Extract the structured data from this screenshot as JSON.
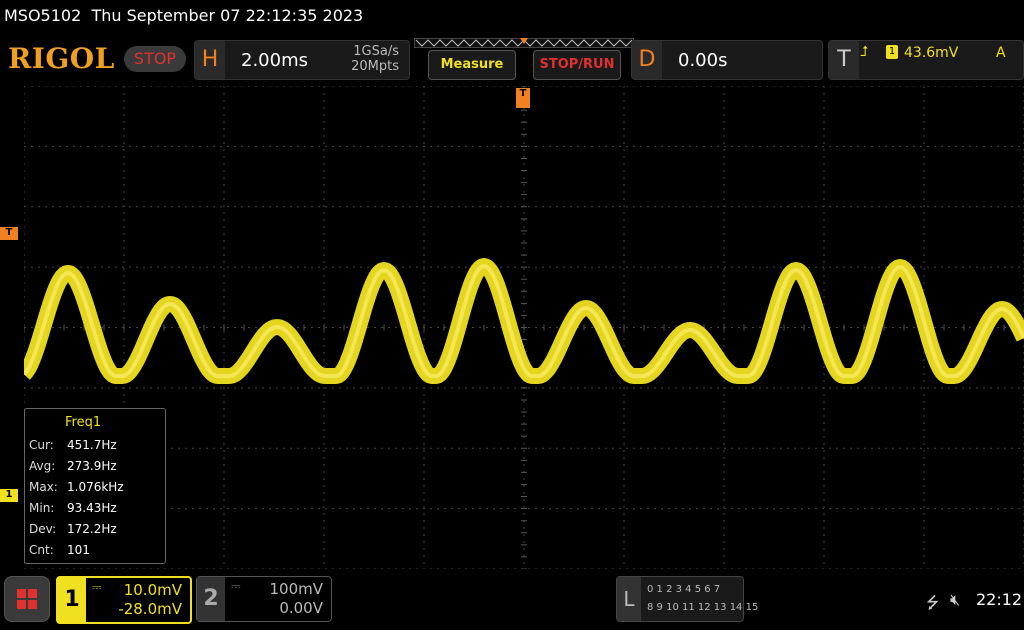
{
  "status_line": {
    "model": "MSO5102",
    "datetime": "Thu September 07 22:12:35 2023"
  },
  "toolbar": {
    "logo": "RIGOL",
    "run_state": "STOP",
    "horizontal": {
      "label": "H",
      "timebase": "2.00ms",
      "sample_rate": "1GSa/s",
      "memory_depth": "20Mpts"
    },
    "measure_label": "Measure",
    "stoprun_label": "STOP/RUN",
    "delay": {
      "label": "D",
      "value": "0.00s"
    },
    "trigger": {
      "label": "T",
      "source": "1",
      "level": "43.6mV",
      "mode": "A"
    }
  },
  "measurement": {
    "title": "Freq1",
    "rows": [
      {
        "key": "Cur:",
        "value": "451.7Hz"
      },
      {
        "key": "Avg:",
        "value": "273.9Hz"
      },
      {
        "key": "Max:",
        "value": "1.076kHz"
      },
      {
        "key": "Min:",
        "value": "93.43Hz"
      },
      {
        "key": "Dev:",
        "value": "172.2Hz"
      },
      {
        "key": "Cnt:",
        "value": "101"
      }
    ]
  },
  "markers": {
    "trigger_level": "T",
    "channel1": "1",
    "trigger_pos": "T"
  },
  "channels": [
    {
      "num": "1",
      "scale": "10.0mV",
      "offset": "-28.0mV",
      "color": "#f0e020"
    },
    {
      "num": "2",
      "scale": "100mV",
      "offset": "0.00V",
      "color": "#888888"
    }
  ],
  "la": {
    "label": "L",
    "row1": "0 1 2 3   4 5 6 7",
    "row2": "8 9 10 11 12 13 14 15"
  },
  "clock": "22:12",
  "colors": {
    "trace": "#f0e020",
    "accent": "#f08020",
    "grid": "#444444"
  }
}
